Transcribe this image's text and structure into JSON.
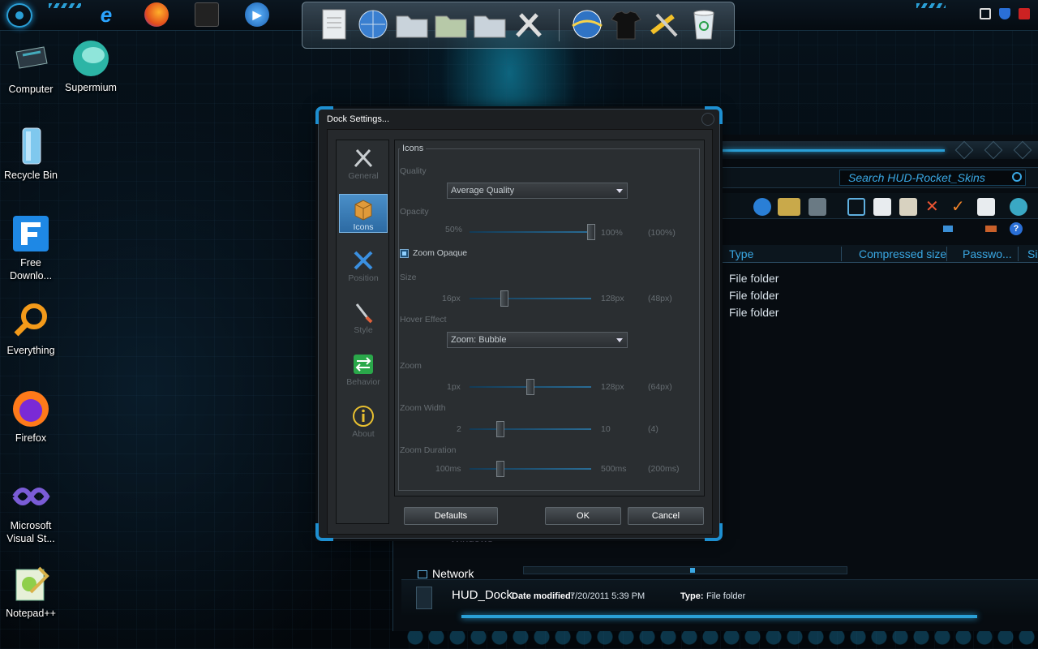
{
  "taskbar": {
    "start_label": "Start",
    "pinned": [
      "internet-explorer",
      "firefox",
      "media-library",
      "media-player",
      "app"
    ],
    "tray_icons": [
      "network-icon",
      "shield-icon",
      "close-icon"
    ]
  },
  "dock": {
    "icons": [
      "document-icon",
      "globe-icon",
      "folder-icon",
      "folder-icon",
      "folder-icon",
      "tools-icon",
      "globe-icon",
      "tshirt-icon",
      "tools-icon",
      "recycle-bin-icon"
    ]
  },
  "desktop": {
    "icons": [
      {
        "label": "Computer",
        "icon": "computer-icon"
      },
      {
        "label": "Supermium",
        "icon": "supermium-icon"
      },
      {
        "label": "Recycle Bin",
        "icon": "recycle-bin-icon"
      },
      {
        "label": "Free Downlo...",
        "icon": "free-download-manager-icon"
      },
      {
        "label": "Everything",
        "icon": "everything-search-icon"
      },
      {
        "label": "Firefox",
        "icon": "firefox-icon"
      },
      {
        "label": "Microsoft Visual St...",
        "icon": "visual-studio-icon"
      },
      {
        "label": "Notepad++",
        "icon": "notepadpp-icon"
      }
    ]
  },
  "explorer": {
    "search_placeholder": "Search HUD-Rocket_Skins",
    "columns": [
      "Type",
      "Compressed size",
      "Passwo...",
      "Si"
    ],
    "rows": [
      "File folder",
      "File folder",
      "File folder"
    ],
    "nav_ghost": "Windows",
    "network_label": "Network",
    "status": {
      "name": "HUD_Dock",
      "date_label": "Date modified:",
      "date_value": "7/20/2011 5:39 PM",
      "type_label": "Type:",
      "type_value": "File folder"
    }
  },
  "dialog": {
    "title": "Dock Settings...",
    "sidebar": [
      {
        "label": "General",
        "icon": "tools-icon",
        "active": false
      },
      {
        "label": "Icons",
        "icon": "box-icon",
        "active": true
      },
      {
        "label": "Position",
        "icon": "position-icon",
        "active": false
      },
      {
        "label": "Style",
        "icon": "brush-icon",
        "active": false
      },
      {
        "label": "Behavior",
        "icon": "behavior-icon",
        "active": false
      },
      {
        "label": "About",
        "icon": "info-icon",
        "active": false
      }
    ],
    "group_title": "Icons",
    "quality": {
      "label": "Quality",
      "value": "Average Quality"
    },
    "opacity": {
      "label": "Opacity",
      "min": "50%",
      "max": "100%",
      "current": "(100%)",
      "level": 1.0
    },
    "zoom_opaque": {
      "label": "Zoom Opaque",
      "checked": true
    },
    "size": {
      "label": "Size",
      "min": "16px",
      "max": "128px",
      "current": "(48px)",
      "level": 0.286
    },
    "hover_effect": {
      "label": "Hover Effect",
      "value": "Zoom: Bubble"
    },
    "zoom": {
      "label": "Zoom",
      "min": "1px",
      "max": "128px",
      "current": "(64px)",
      "level": 0.5
    },
    "zoom_width": {
      "label": "Zoom Width",
      "min": "2",
      "max": "10",
      "current": "(4)",
      "level": 0.25
    },
    "zoom_duration": {
      "label": "Zoom Duration",
      "min": "100ms",
      "max": "500ms",
      "current": "(200ms)",
      "level": 0.25
    },
    "buttons": {
      "defaults": "Defaults",
      "ok": "OK",
      "cancel": "Cancel"
    }
  }
}
